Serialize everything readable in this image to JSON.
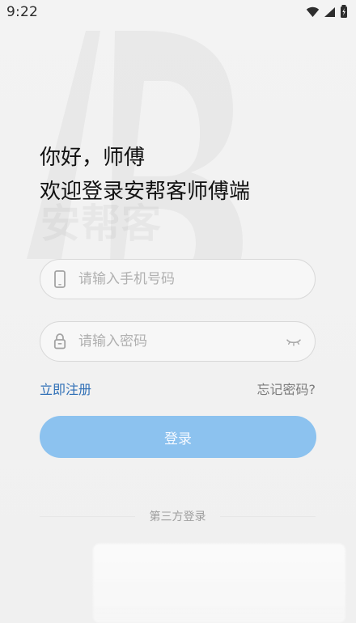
{
  "status_bar": {
    "time": "9:22",
    "icons": [
      "wifi-icon",
      "signal-icon",
      "battery-icon"
    ]
  },
  "watermark": {
    "brand_text": "安帮客"
  },
  "greeting": {
    "line1": "你好，师傅",
    "line2": "欢迎登录安帮客师傅端"
  },
  "form": {
    "phone": {
      "icon": "phone-icon",
      "placeholder": "请输入手机号码",
      "value": ""
    },
    "password": {
      "icon": "lock-icon",
      "placeholder": "请输入密码",
      "value": "",
      "toggle_icon": "eye-closed-icon"
    }
  },
  "links": {
    "register": "立即注册",
    "forgot_password": "忘记密码?"
  },
  "actions": {
    "login": "登录"
  },
  "third_party": {
    "label": "第三方登录"
  },
  "colors": {
    "link_blue": "#2f6fb6",
    "login_button": "#8cc2ef",
    "background": "#f1f1f1"
  }
}
